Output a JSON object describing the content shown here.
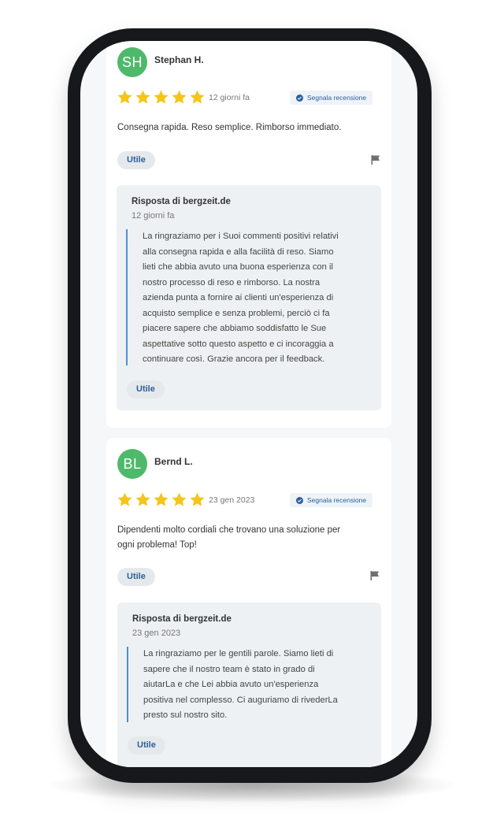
{
  "reviews": [
    {
      "avatar_initials": "SH",
      "avatar_color": "#4fb96b",
      "name": "Stephan H.",
      "rating": 5,
      "date": "12 giorni fa",
      "report_label": "Segnala recensione",
      "text": "Consegna rapida. Reso semplice. Rimborso immediato.",
      "helpful_label": "Utile",
      "flag_icon": "flag-icon",
      "reply": {
        "title": "Risposta di bergzeit.de",
        "date": "12 giorni fa",
        "lines": [
          "La ringraziamo per i Suoi commenti positivi relativi",
          "alla consegna rapida e alla facilità di reso. Siamo",
          "lieti che abbia avuto una buona esperienza con il",
          "nostro processo di reso e rimborso. La nostra",
          "azienda punta a fornire ai clienti un'esperienza di",
          "acquisto semplice e senza problemi, perciò ci fa",
          "piacere sapere che abbiamo soddisfatto le Sue",
          "aspettative sotto questo aspetto e ci incoraggia a",
          "continuare così. Grazie ancora per il feedback."
        ],
        "helpful_label": "Utile"
      }
    },
    {
      "avatar_initials": "BL",
      "avatar_color": "#4fb96b",
      "name": "Bernd L.",
      "rating": 5,
      "date": "23 gen 2023",
      "report_label": "Segnala recensione",
      "text_lines": [
        "Dipendenti molto cordiali che trovano una soluzione per",
        "ogni problema! Top!"
      ],
      "helpful_label": "Utile",
      "flag_icon": "flag-icon",
      "reply": {
        "title": "Risposta di bergzeit.de",
        "date": "23 gen 2023",
        "lines": [
          "La ringraziamo per le gentili parole. Siamo lieti di",
          "sapere che il nostro team è stato in grado di",
          "aiutarLa e che Lei abbia avuto un'esperienza",
          "positiva nel complesso. Ci auguriamo di rivederLa",
          "presto sul nostro sito."
        ],
        "helpful_label": "Utile"
      }
    }
  ],
  "colors": {
    "star": "#f5c518",
    "avatar": "#4fb96b",
    "accent": "#2b5f9c",
    "reply_bar": "#4a90d9",
    "phone_frame": "#16181b"
  }
}
